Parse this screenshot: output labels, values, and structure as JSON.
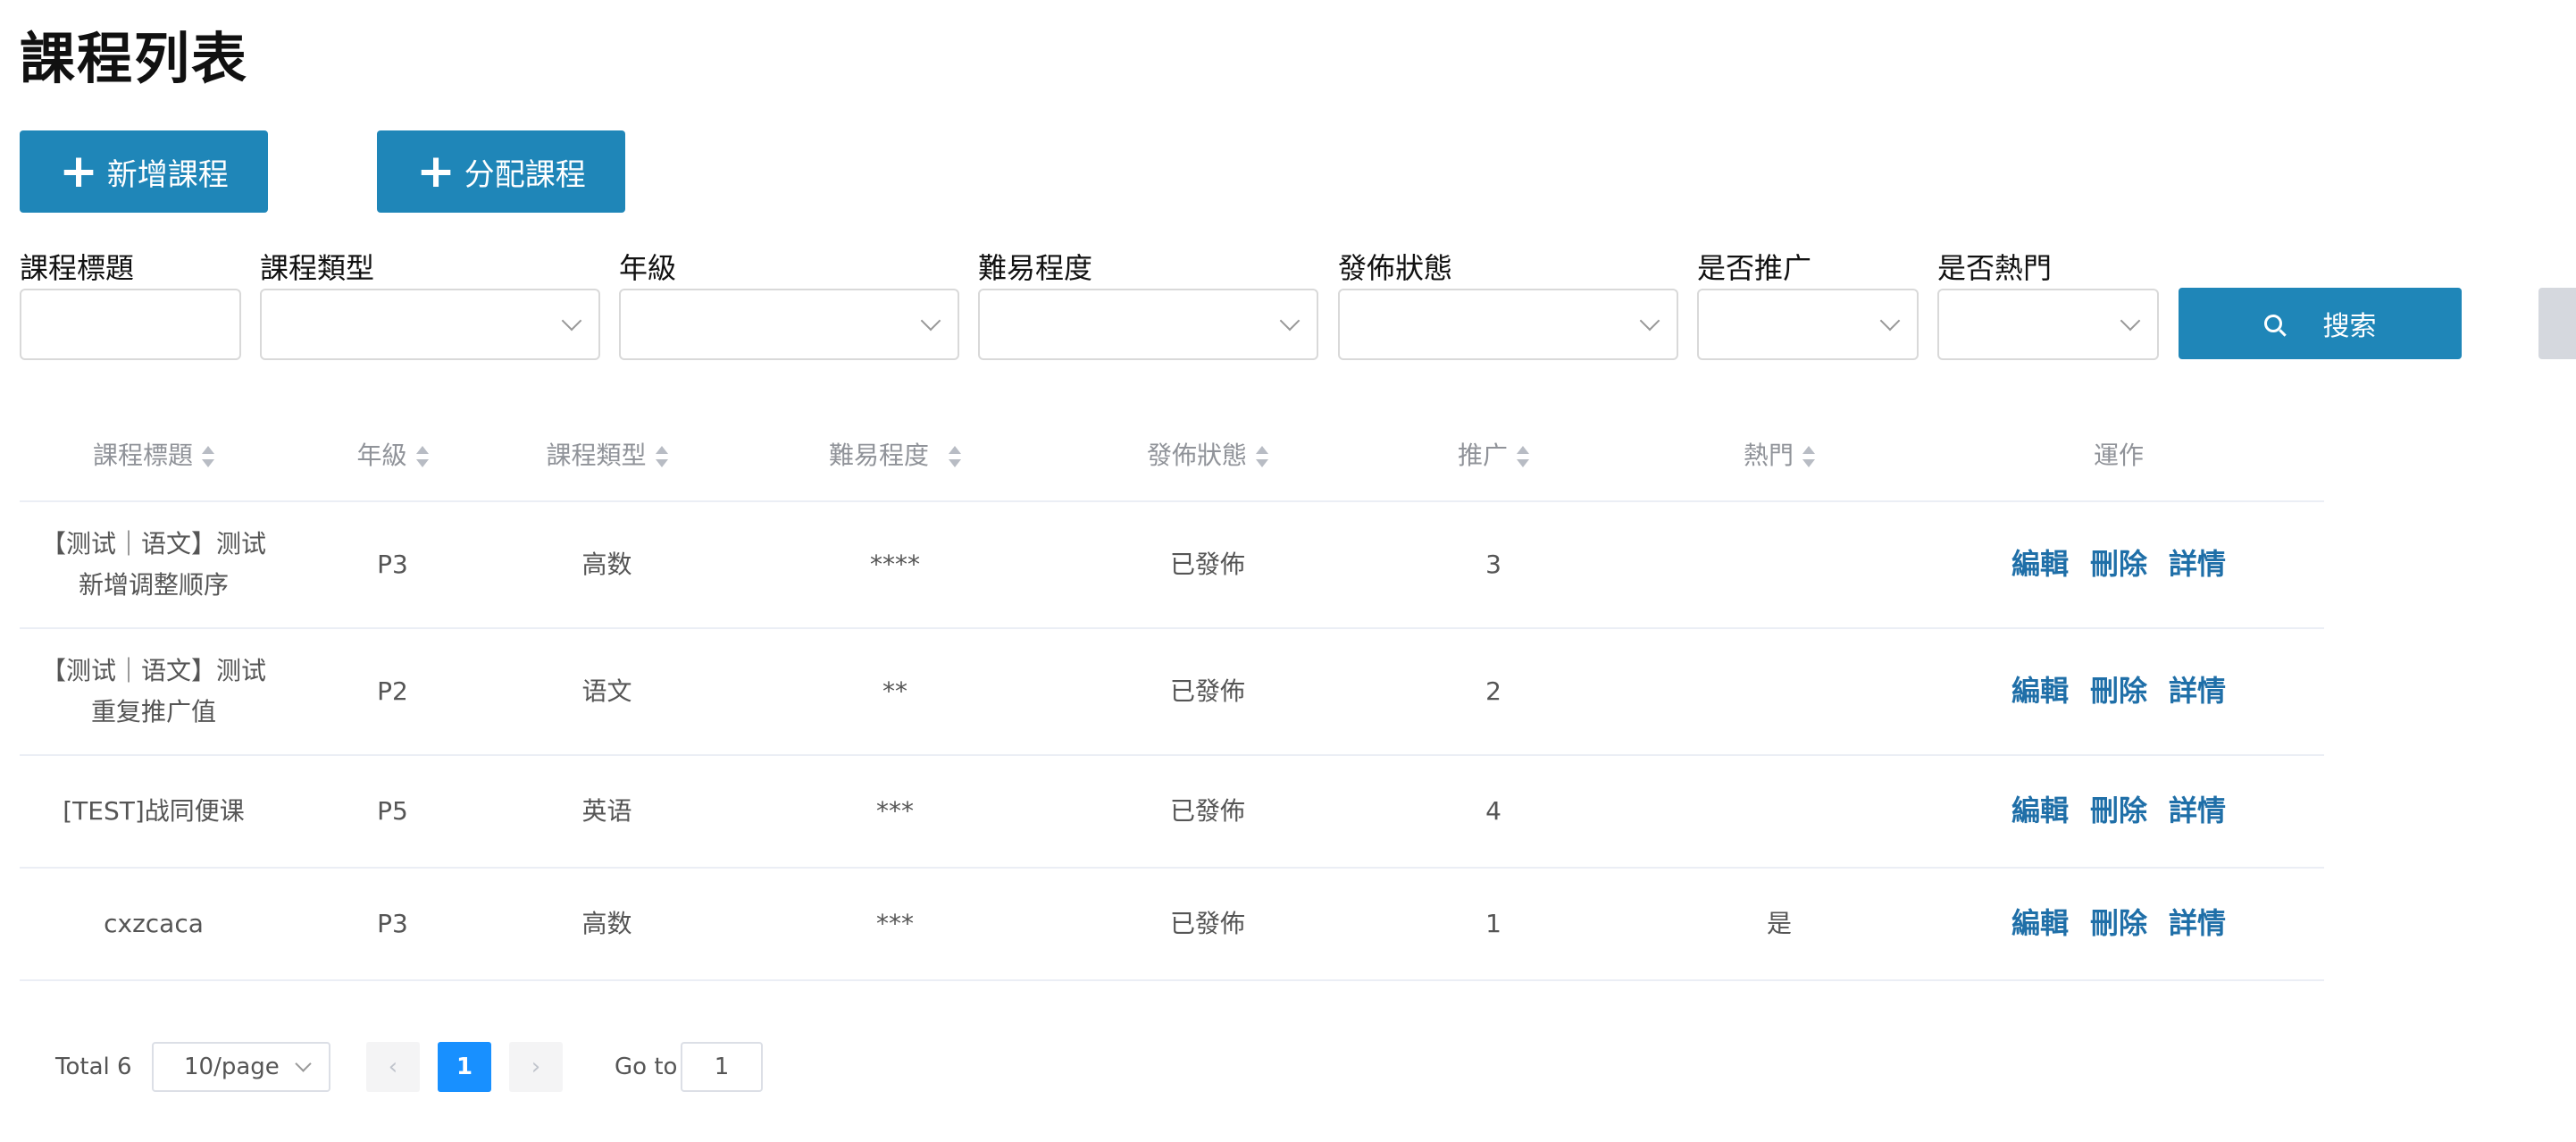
{
  "page": {
    "title": "課程列表"
  },
  "actions": {
    "add_label": "新增課程",
    "assign_label": "分配課程"
  },
  "filters": {
    "title_label": "課程標題",
    "type_label": "課程類型",
    "grade_label": "年級",
    "difficulty_label": "難易程度",
    "status_label": "發佈狀態",
    "promote_label": "是否推广",
    "hot_label": "是否熱門",
    "search_label": "搜索"
  },
  "table": {
    "headers": {
      "title": "課程標題",
      "grade": "年級",
      "type": "課程類型",
      "difficulty": "難易程度",
      "status": "發佈狀態",
      "promote": "推广",
      "hot": "熱門",
      "ops": "運作"
    },
    "rows": [
      {
        "title": "【测试｜语文】测试新增调整顺序",
        "grade": "P3",
        "type": "高数",
        "difficulty": "****",
        "status": "已發佈",
        "promote": "3",
        "hot": ""
      },
      {
        "title": "【测试｜语文】测试重复推广值",
        "grade": "P2",
        "type": "语文",
        "difficulty": "**",
        "status": "已發佈",
        "promote": "2",
        "hot": ""
      },
      {
        "title": "[TEST]战同便课",
        "grade": "P5",
        "type": "英语",
        "difficulty": "***",
        "status": "已發佈",
        "promote": "4",
        "hot": ""
      },
      {
        "title": "cxzcaca",
        "grade": "P3",
        "type": "高数",
        "difficulty": "***",
        "status": "已發佈",
        "promote": "1",
        "hot": "是"
      }
    ],
    "ops": {
      "edit": "編輯",
      "delete": "刪除",
      "detail": "詳情"
    }
  },
  "pagination": {
    "total": "Total 6",
    "page_size": "10/page",
    "current_page": "1",
    "goto_label": "Go to",
    "goto_value": "1"
  }
}
